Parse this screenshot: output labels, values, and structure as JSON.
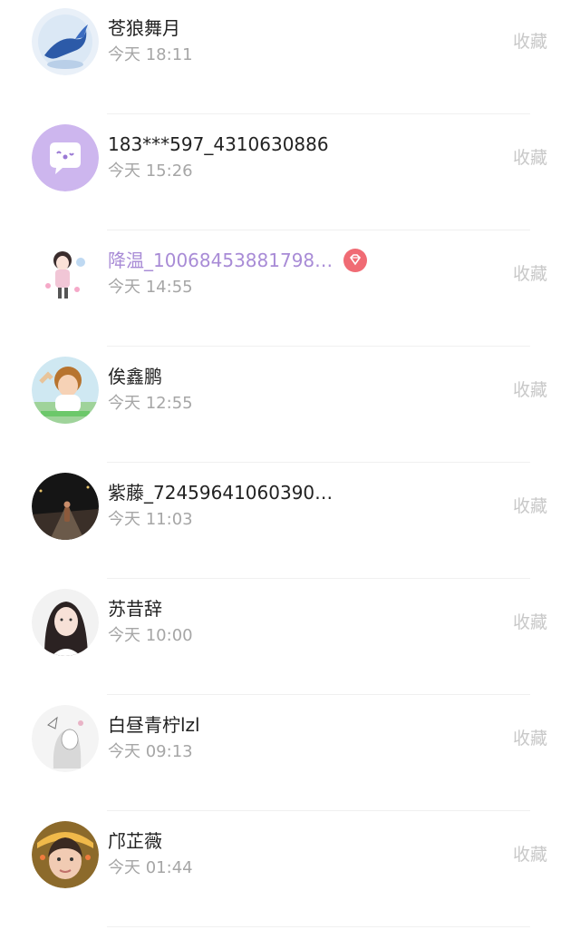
{
  "fav_label": "收藏",
  "items": [
    {
      "name": "苍狼舞月",
      "time": "今天 18:11",
      "avatar": "whale-avatar",
      "vip": false
    },
    {
      "name": "183***597_4310630886",
      "time": "今天 15:26",
      "avatar": "chat-bubble-avatar",
      "vip": false
    },
    {
      "name": "降温_10068453881798…",
      "time": "今天 14:55",
      "avatar": "cartoon-girl-avatar",
      "vip": true
    },
    {
      "name": "俟鑫鹏",
      "time": "今天 12:55",
      "avatar": "girl-photo-avatar",
      "vip": false
    },
    {
      "name": "紫藤_72459641060390…",
      "time": "今天 11:03",
      "avatar": "night-road-avatar",
      "vip": false
    },
    {
      "name": "苏昔辞",
      "time": "今天 10:00",
      "avatar": "woman-portrait-avatar",
      "vip": false
    },
    {
      "name": "白昼青柠lzl",
      "time": "今天 09:13",
      "avatar": "sketch-girl-avatar",
      "vip": false
    },
    {
      "name": "邝芷薇",
      "time": "今天 01:44",
      "avatar": "selfie-avatar",
      "vip": false
    }
  ],
  "colors": {
    "vip_name": "#a88bd6",
    "vip_badge": "#f06b74",
    "time": "#a6a6a6",
    "fav": "#c8c8c8",
    "bubble_bg": "#cdb6ee"
  }
}
